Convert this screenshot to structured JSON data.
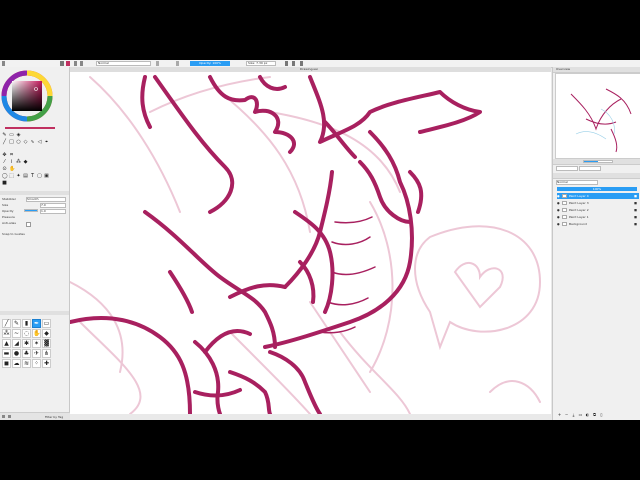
{
  "topbar": {
    "brush_name": "Normal",
    "tab_active": "Opacity: 100%",
    "size_readout": "Size: 7.39 px"
  },
  "document": {
    "tab_title": "Drawing.sai"
  },
  "tool_properties": {
    "stabilizer_label": "Stabilizer",
    "stabilizer_value": "Smooth",
    "size_label": "Size",
    "size_value": "7.0",
    "opacity_label": "Opacity",
    "opacity_value": "1.0",
    "pressure_label": "Pressure",
    "antialias_label": "Anti-alias",
    "snap_label": "Snap to Guides"
  },
  "right_panel": {
    "overview_title": "Overview",
    "blend_mode": "Normal",
    "opacity_value": "100%",
    "layers": [
      {
        "name": "Paint Layer 4",
        "selected": true
      },
      {
        "name": "Paint Layer 3",
        "selected": false
      },
      {
        "name": "Paint Layer 2",
        "selected": false
      },
      {
        "name": "Paint Layer 1",
        "selected": false
      },
      {
        "name": "Background",
        "selected": false
      }
    ]
  },
  "status": {
    "text": "Filter by Tag"
  },
  "colors": {
    "ink": "#a8205f",
    "sketch": "#edc7d6",
    "accent": "#2a9df4",
    "panel_bg": "#f0f0f0"
  },
  "icons": {
    "tools": [
      "pen-icon",
      "eraser-icon",
      "fill-icon",
      "select-icon",
      "move-icon",
      "zoom-icon",
      "eyedropper-icon",
      "lasso-icon",
      "text-icon",
      "shape-icon"
    ],
    "layer_actions": [
      "new-layer-icon",
      "delete-layer-icon",
      "merge-icon",
      "folder-icon",
      "mask-icon"
    ]
  }
}
